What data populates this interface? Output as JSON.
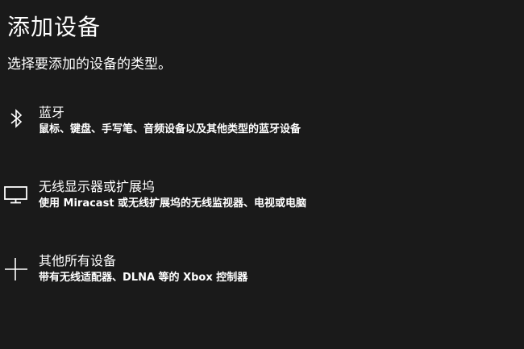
{
  "dialog": {
    "title": "添加设备",
    "subtitle": "选择要添加的设备的类型。"
  },
  "options": [
    {
      "name": "蓝牙",
      "description": "鼠标、键盘、手写笔、音频设备以及其他类型的蓝牙设备",
      "icon": "bluetooth-icon"
    },
    {
      "name": "无线显示器或扩展坞",
      "description": "使用 Miracast 或无线扩展坞的无线监视器、电视或电脑",
      "icon": "monitor-icon"
    },
    {
      "name": "其他所有设备",
      "description": "带有无线适配器、DLNA 等的 Xbox 控制器",
      "icon": "plus-icon"
    }
  ]
}
